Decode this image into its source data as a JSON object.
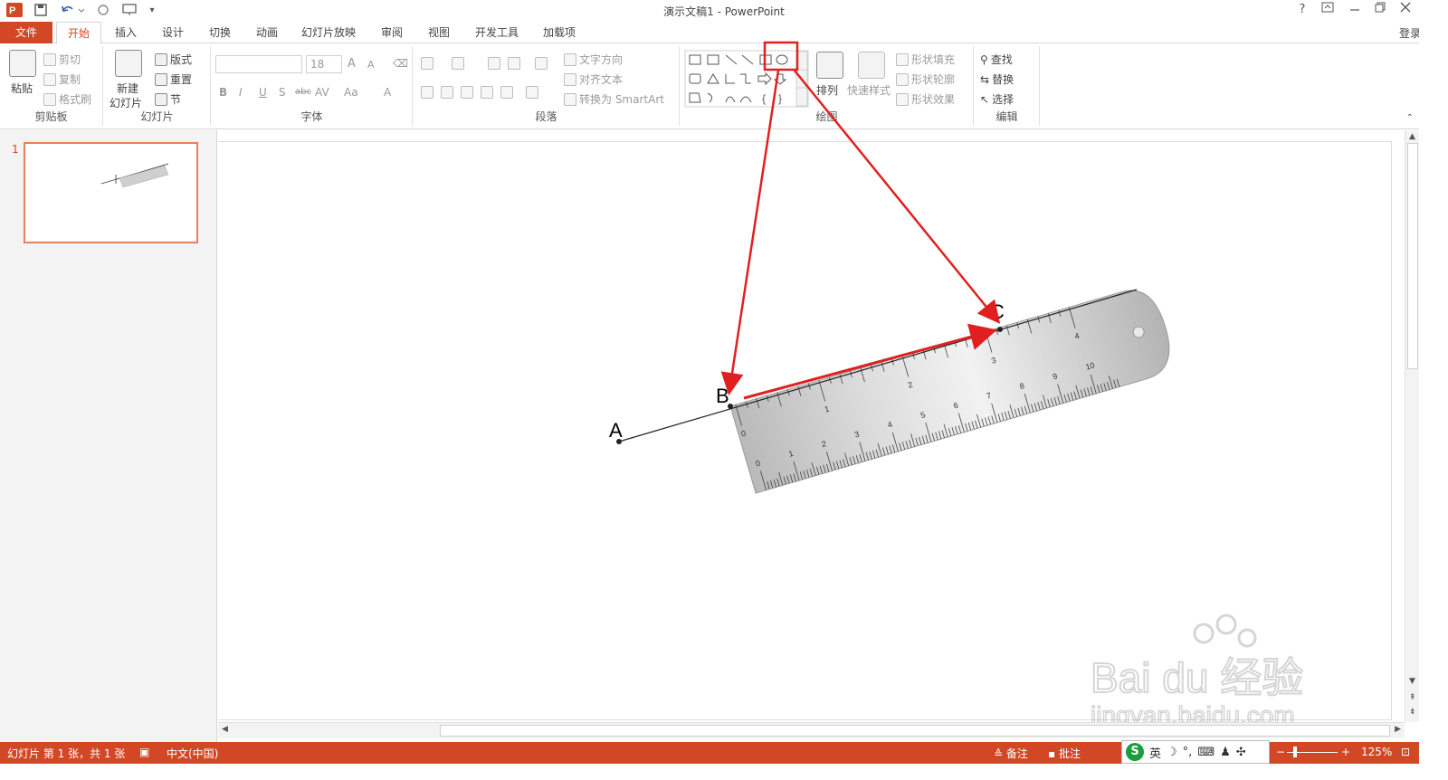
{
  "window": {
    "title": "演示文稿1 - PowerPoint",
    "help": "?",
    "login": "登录"
  },
  "tabs": [
    "文件",
    "开始",
    "插入",
    "设计",
    "切换",
    "动画",
    "幻灯片放映",
    "审阅",
    "视图",
    "开发工具",
    "加载项"
  ],
  "ribbon": {
    "clipboard": {
      "paste": "粘贴",
      "cut": "剪切",
      "copy": "复制",
      "format_painter": "格式刷",
      "label": "剪贴板"
    },
    "slides": {
      "new_slide_1": "新建",
      "new_slide_2": "幻灯片",
      "layout": "版式",
      "reset": "重置",
      "section": "节",
      "label": "幻灯片"
    },
    "font": {
      "size": "18",
      "bold": "B",
      "italic": "I",
      "underline": "U",
      "shadow": "S",
      "strike": "abc",
      "spacing": "AV",
      "case": "Aa",
      "color": "A",
      "grow": "A",
      "shrink": "A",
      "label": "字体"
    },
    "paragraph": {
      "text_direction": "文字方向",
      "align_text": "对齐文本",
      "smartart": "转换为 SmartArt",
      "label": "段落"
    },
    "drawing": {
      "arrange": "排列",
      "quick_styles": "快速样式",
      "shape_fill": "形状填充",
      "shape_outline": "形状轮廓",
      "shape_effects": "形状效果",
      "label": "绘图"
    },
    "editing": {
      "find": "查找",
      "replace": "替换",
      "select": "选择",
      "label": "编辑"
    }
  },
  "slides_pane": {
    "slide_number": "1"
  },
  "slide": {
    "points": [
      "A",
      "B",
      "C"
    ],
    "ruler_cm": [
      "0",
      "1",
      "2",
      "3",
      "4",
      "5",
      "6",
      "7",
      "8",
      "9",
      "10"
    ],
    "ruler_in": [
      "0",
      "1",
      "2",
      "3",
      "4"
    ]
  },
  "status": {
    "slide_info": "幻灯片 第 1 张，共 1 张",
    "language": "中文(中国)",
    "notes": "备注",
    "comments": "批注",
    "zoom": "125%",
    "ime_lang": "英"
  },
  "watermark": {
    "brand": "Bai du 经验",
    "url": "jingyan.baidu.com"
  },
  "colors": {
    "accent": "#d24726",
    "annotation": "#e02020"
  }
}
